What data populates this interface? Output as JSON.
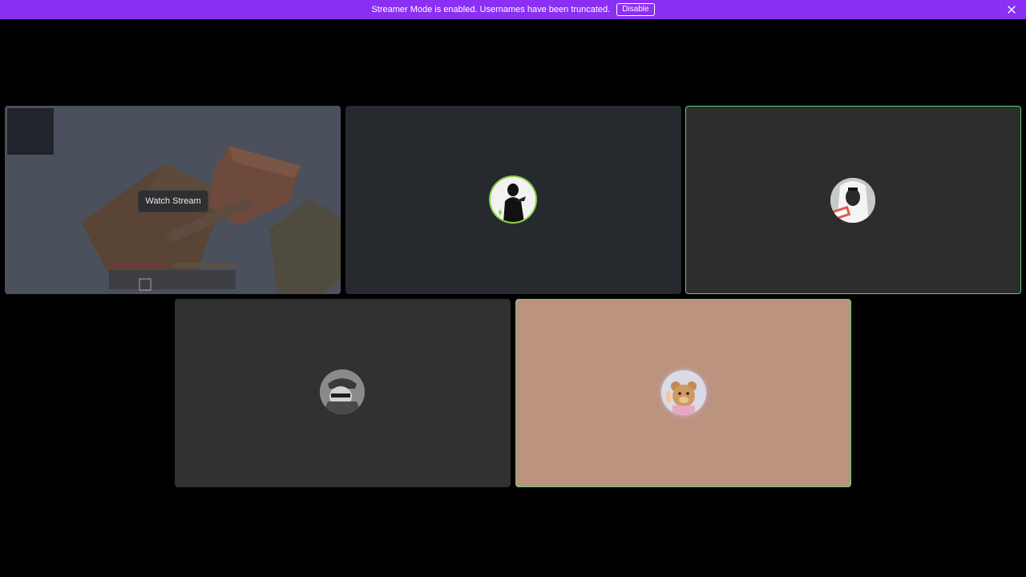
{
  "banner": {
    "message": "Streamer Mode is enabled. Usernames have been truncated.",
    "disable_label": "Disable",
    "close_icon": "close-icon",
    "color": "#8b2ff5"
  },
  "tiles": [
    {
      "name": "stream-tile",
      "bg": "#3b3d45",
      "action_label": "Watch Stream"
    },
    {
      "name": "participant-tile-2",
      "bg": "#26292e",
      "avatar_icon": "avatar-silhouette"
    },
    {
      "name": "participant-tile-3",
      "bg": "#2d2d2d",
      "speaking": true,
      "avatar_icon": "avatar-headscarf"
    },
    {
      "name": "participant-tile-4",
      "bg": "#313131",
      "avatar_icon": "avatar-cap"
    },
    {
      "name": "participant-tile-5",
      "bg": "#bc937e",
      "speaking": true,
      "avatar_icon": "avatar-teddy-bear"
    }
  ],
  "colors": {
    "speaking_border": "#5fd27a",
    "background": "#000000"
  }
}
